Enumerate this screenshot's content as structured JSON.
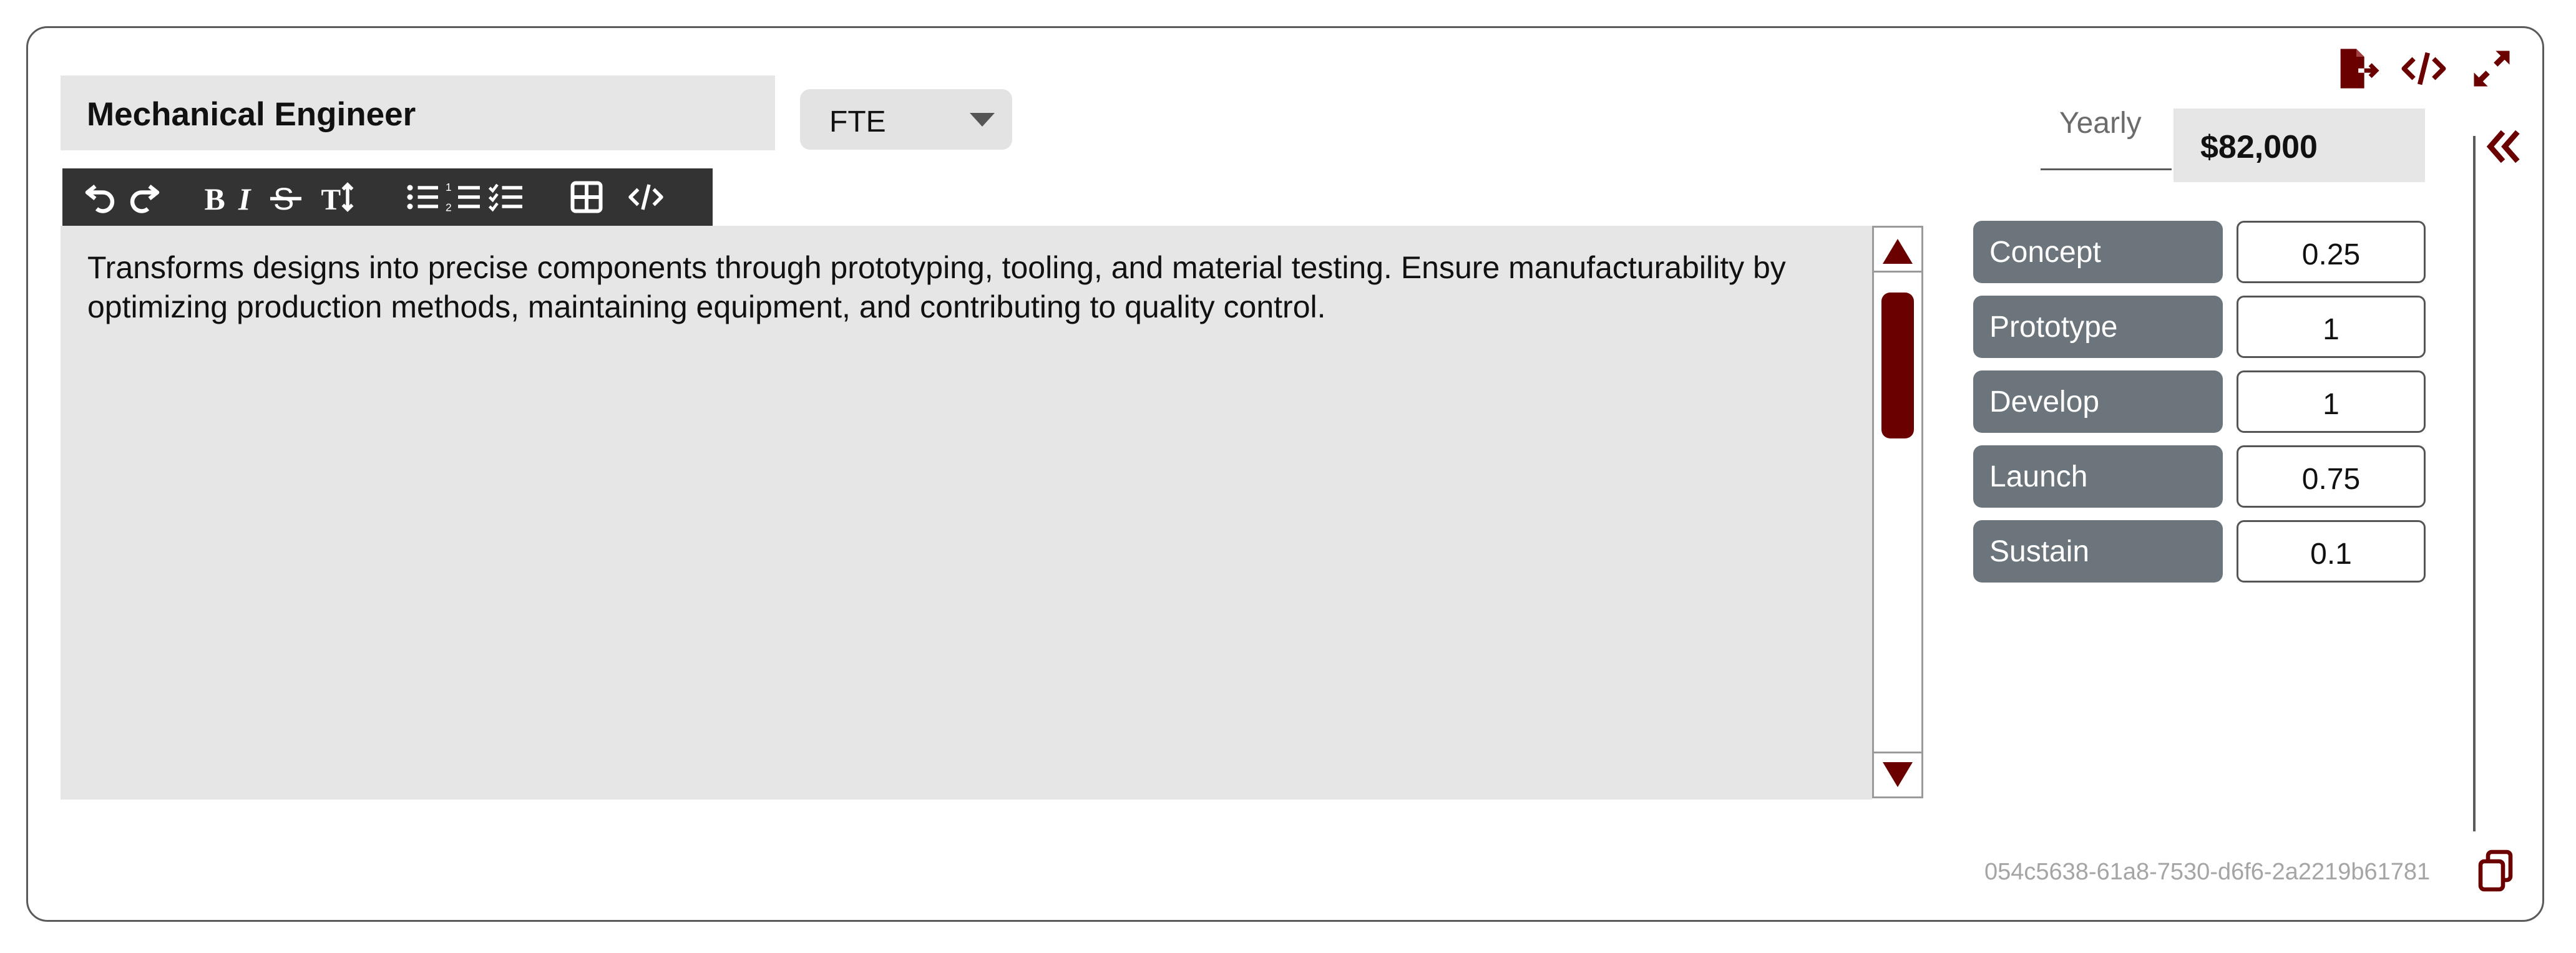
{
  "role": {
    "title": "Mechanical Engineer",
    "employment_type": "FTE",
    "description": "Transforms designs into precise components through prototyping, tooling, and material testing. Ensure manufacturability by optimizing production methods, maintaining equipment, and contributing to quality control."
  },
  "toolbar": {
    "buttons": [
      "undo-icon",
      "redo-icon",
      "bold-icon",
      "italic-icon",
      "strikethrough-icon",
      "text-size-icon",
      "bullet-list-icon",
      "numbered-list-icon",
      "checklist-icon",
      "table-icon",
      "code-icon"
    ]
  },
  "compensation": {
    "period_label": "Yearly",
    "amount": "$82,000"
  },
  "phases": [
    {
      "label": "Concept",
      "value": "0.25"
    },
    {
      "label": "Prototype",
      "value": "1"
    },
    {
      "label": "Develop",
      "value": "1"
    },
    {
      "label": "Launch",
      "value": "0.75"
    },
    {
      "label": "Sustain",
      "value": "0.1"
    }
  ],
  "record_id": "054c5638-61a8-7530-d6f6-2a2219b61781",
  "colors": {
    "accent": "#6b0000",
    "toolbar_bg": "#333333",
    "phase_label_bg": "#6b757b",
    "field_bg": "#e6e6e6"
  }
}
